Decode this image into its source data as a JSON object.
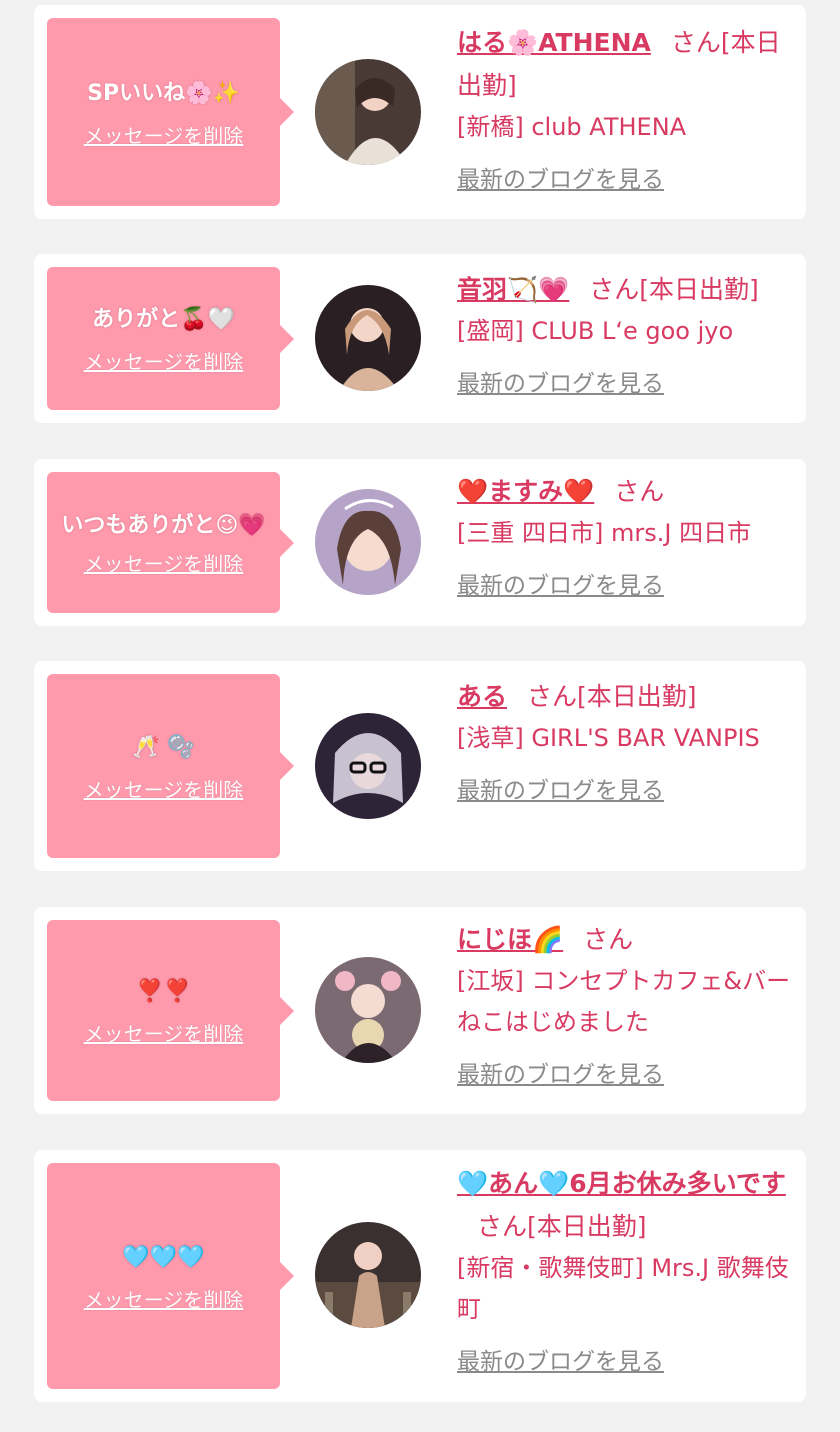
{
  "delete_label": "メッセージを削除",
  "blog_label": "最新のブログを見る",
  "san": "さん",
  "colors": {
    "background": "#f2f2f2",
    "card": "#ffffff",
    "bubble": "#ff9aad",
    "accent_text": "#d83a62",
    "muted_link": "#8a8a8a"
  },
  "items": [
    {
      "message": "SPいいね🌸✨",
      "name": "はる🌸ATHENA",
      "status": "[本日出勤]",
      "shop": "[新橋] club ATHENA",
      "avatar_icon": "avatar-photo-icon"
    },
    {
      "message": "ありがと🍒🤍",
      "name": "音羽🏹💗",
      "status": "[本日出勤]",
      "shop": "[盛岡] CLUB L‘e goo jyo",
      "avatar_icon": "avatar-photo-icon"
    },
    {
      "message": "いつもありがと😉💗",
      "name": "❤️ますみ❤️",
      "status": "",
      "shop": "[三重 四日市] mrs.J 四日市",
      "avatar_icon": "avatar-photo-icon"
    },
    {
      "message": "🥂 🫧",
      "name": "ある",
      "status": "[本日出勤]",
      "shop": "[浅草] GIRL'S BAR VANPIS",
      "avatar_icon": "avatar-photo-icon"
    },
    {
      "message": "❣️❣️",
      "name": "にじほ🌈",
      "status": "",
      "shop": "[江坂] コンセプトカフェ&バー　ねこはじめました",
      "avatar_icon": "avatar-photo-icon"
    },
    {
      "message": "🩵🩵🩵",
      "name": "🩵あん🩵6月お休み多いです",
      "status": "[本日出勤]",
      "shop": "[新宿・歌舞伎町] Mrs.J 歌舞伎町",
      "avatar_icon": "avatar-photo-icon"
    }
  ]
}
